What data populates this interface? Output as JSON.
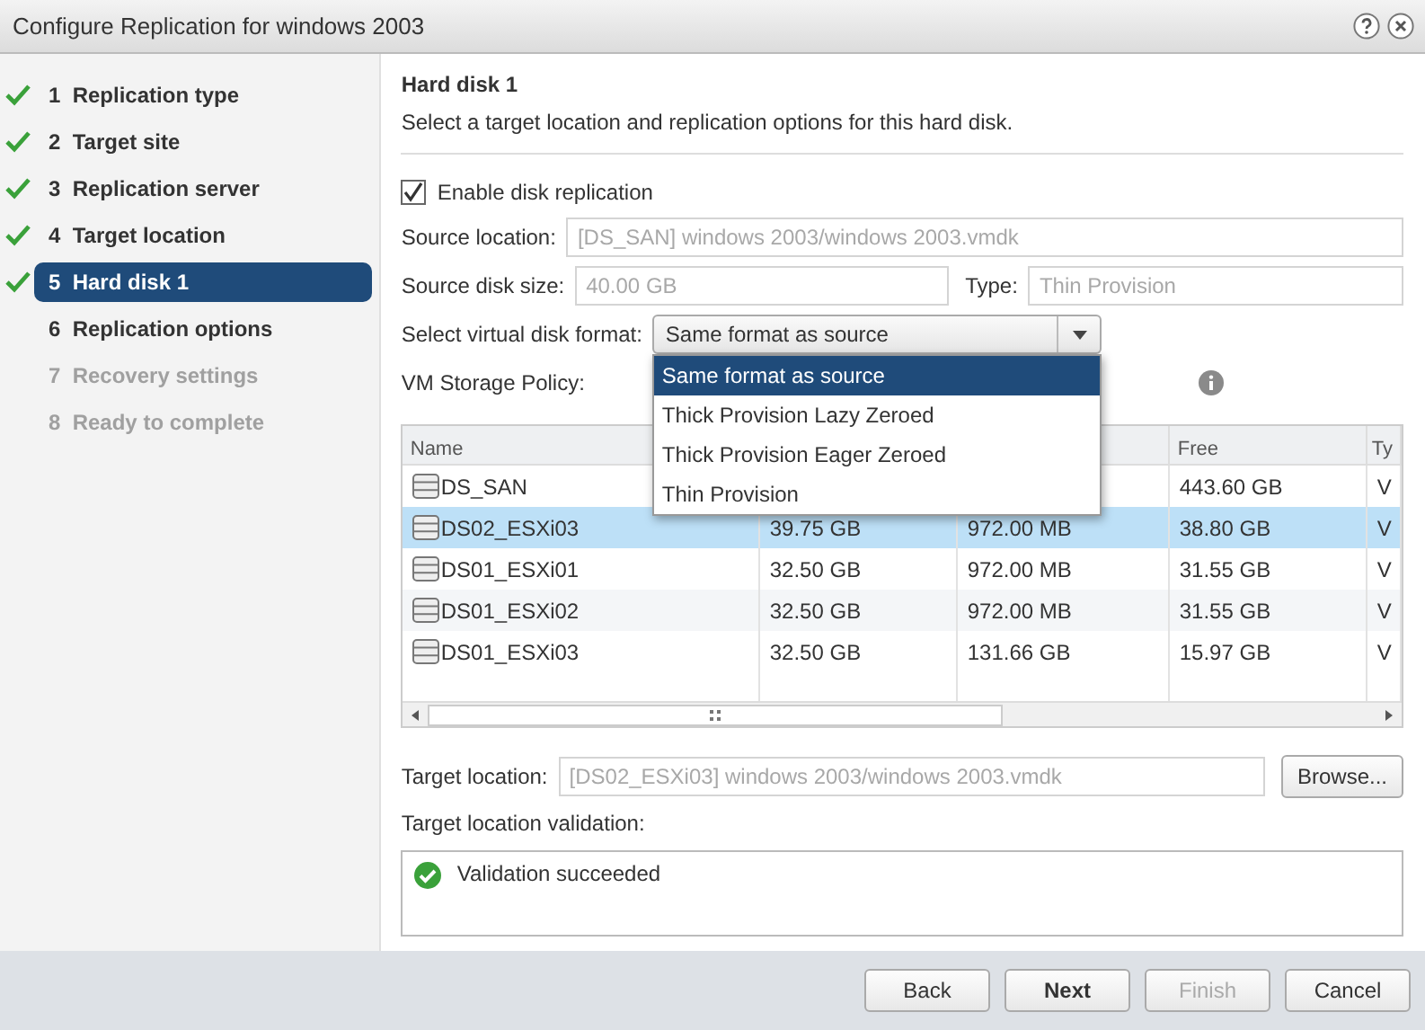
{
  "window": {
    "title": "Configure Replication for windows 2003"
  },
  "steps": [
    {
      "number": "1",
      "label": "Replication type",
      "done": true,
      "selected": false,
      "disabled": false
    },
    {
      "number": "2",
      "label": "Target site",
      "done": true,
      "selected": false,
      "disabled": false
    },
    {
      "number": "3",
      "label": "Replication server",
      "done": true,
      "selected": false,
      "disabled": false
    },
    {
      "number": "4",
      "label": "Target location",
      "done": true,
      "selected": false,
      "disabled": false
    },
    {
      "number": "5",
      "label": "Hard disk 1",
      "done": true,
      "selected": true,
      "disabled": false
    },
    {
      "number": "6",
      "label": "Replication options",
      "done": false,
      "selected": false,
      "disabled": false
    },
    {
      "number": "7",
      "label": "Recovery settings",
      "done": false,
      "selected": false,
      "disabled": true
    },
    {
      "number": "8",
      "label": "Ready to complete",
      "done": false,
      "selected": false,
      "disabled": true
    }
  ],
  "page": {
    "title": "Hard disk 1",
    "subtitle": "Select a target location and replication options for this hard disk."
  },
  "enable_replication": {
    "label": "Enable disk replication",
    "checked": true
  },
  "source_location": {
    "label": "Source location:",
    "value": "[DS_SAN] windows 2003/windows 2003.vmdk"
  },
  "source_disk_size": {
    "label": "Source disk size:",
    "value": "40.00 GB"
  },
  "type": {
    "label": "Type:",
    "value": "Thin Provision"
  },
  "disk_format": {
    "label": "Select virtual disk format:",
    "value": "Same format as source",
    "expanded": true,
    "options": [
      {
        "label": "Same format as source",
        "selected": true
      },
      {
        "label": "Thick Provision Lazy Zeroed",
        "selected": false
      },
      {
        "label": "Thick Provision Eager Zeroed",
        "selected": false
      },
      {
        "label": "Thin Provision",
        "selected": false
      }
    ]
  },
  "storage_policy": {
    "label": "VM Storage Policy:"
  },
  "table": {
    "columns": [
      {
        "heading": "Name"
      },
      {},
      {},
      {
        "heading": "Free"
      },
      {
        "heading": "Ty"
      }
    ],
    "rows": [
      {
        "cells": [
          "DS_SAN",
          null,
          null,
          "443.60 GB",
          "V"
        ],
        "selected": false
      },
      {
        "cells": [
          "DS02_ESXi03",
          "39.75 GB",
          "972.00 MB",
          "38.80 GB",
          "V"
        ],
        "selected": true
      },
      {
        "cells": [
          "DS01_ESXi01",
          "32.50 GB",
          "972.00 MB",
          "31.55 GB",
          "V"
        ],
        "selected": false
      },
      {
        "cells": [
          "DS01_ESXi02",
          "32.50 GB",
          "972.00 MB",
          "31.55 GB",
          "V"
        ],
        "selected": false
      },
      {
        "cells": [
          "DS01_ESXi03",
          "32.50 GB",
          "131.66 GB",
          "15.97 GB",
          "V"
        ],
        "selected": false
      }
    ]
  },
  "target_location": {
    "label": "Target location:",
    "value": "[DS02_ESXi03] windows 2003/windows 2003.vmdk",
    "button": "Browse..."
  },
  "validation": {
    "label": "Target location validation:",
    "message": "Validation succeeded"
  },
  "buttons": [
    {
      "label": "Back",
      "primary": false,
      "disabled": false
    },
    {
      "label": "Next",
      "primary": true,
      "disabled": false
    },
    {
      "label": "Finish",
      "primary": false,
      "disabled": true
    },
    {
      "label": "Cancel",
      "primary": false,
      "disabled": false
    }
  ]
}
